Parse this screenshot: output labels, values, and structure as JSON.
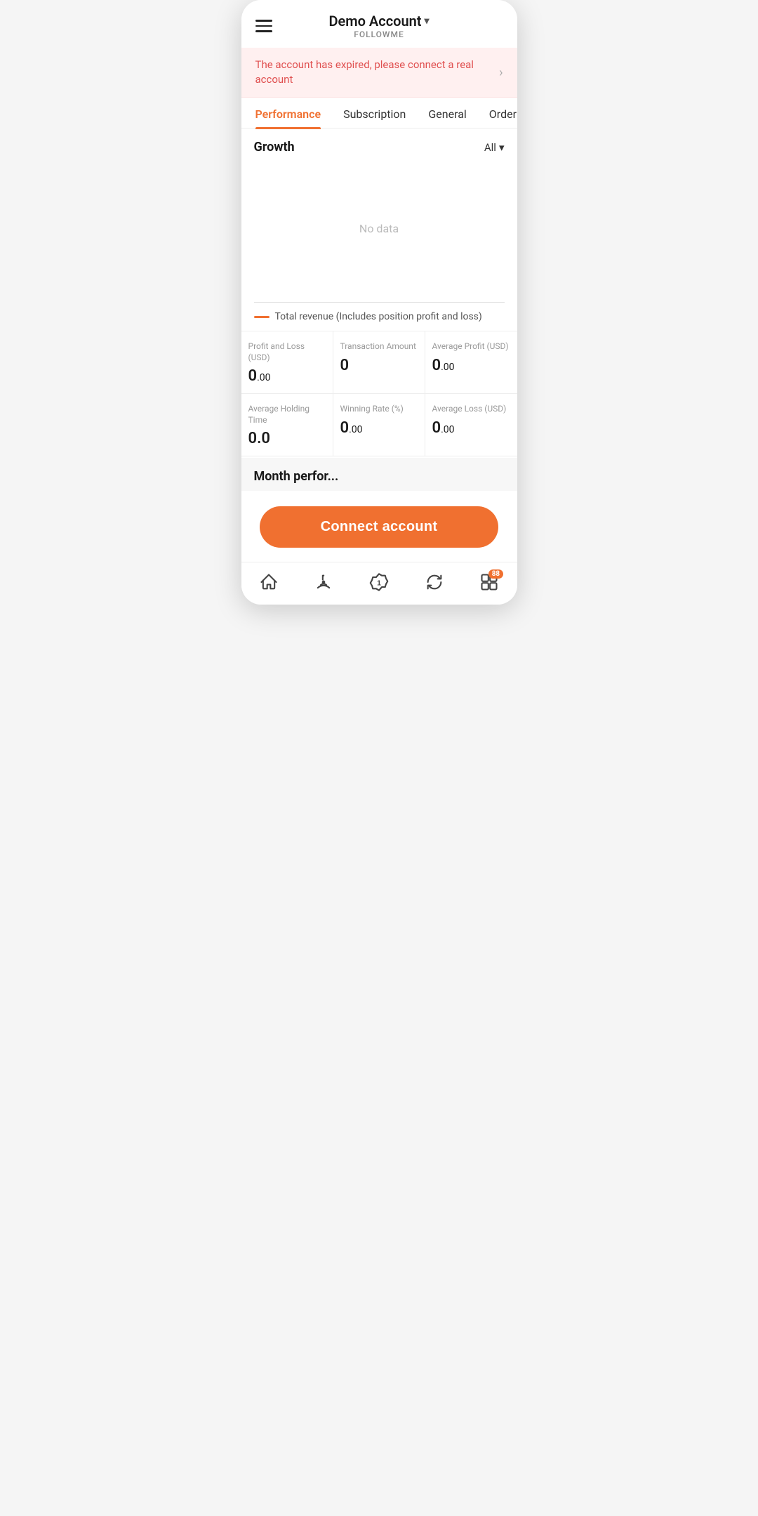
{
  "header": {
    "account_name": "Demo Account",
    "account_chevron": "▾",
    "subtitle": "FOLLOWME"
  },
  "alert": {
    "text": "The account has expired, please connect a real account",
    "chevron": "›"
  },
  "tabs": [
    {
      "id": "performance",
      "label": "Performance",
      "active": true
    },
    {
      "id": "subscription",
      "label": "Subscription",
      "active": false
    },
    {
      "id": "general",
      "label": "General",
      "active": false
    },
    {
      "id": "order",
      "label": "Order",
      "active": false
    }
  ],
  "growth": {
    "title": "Growth",
    "filter": "All",
    "no_data": "No data",
    "legend": "Total revenue (Includes position profit and loss)"
  },
  "stats": [
    {
      "label": "Profit and Loss (USD)",
      "value": "0",
      "decimals": ".00"
    },
    {
      "label": "Transaction Amount",
      "value": "0",
      "decimals": ""
    },
    {
      "label": "Average Profit (USD)",
      "value": "0",
      "decimals": ".00"
    },
    {
      "label": "Average Holding Time",
      "value": "0.0",
      "decimals": ""
    },
    {
      "label": "Winning Rate (%)",
      "value": "0",
      "decimals": ".00"
    },
    {
      "label": "Average Loss (USD)",
      "value": "0",
      "decimals": ".00"
    }
  ],
  "month_performance": {
    "title": "Month perfor..."
  },
  "connect_button": {
    "label": "Connect account"
  },
  "bottom_nav": [
    {
      "id": "home",
      "icon": "home"
    },
    {
      "id": "signal",
      "icon": "signal"
    },
    {
      "id": "badge",
      "icon": "badge"
    },
    {
      "id": "refresh",
      "icon": "refresh"
    },
    {
      "id": "profile",
      "icon": "profile",
      "badge": "88"
    }
  ]
}
